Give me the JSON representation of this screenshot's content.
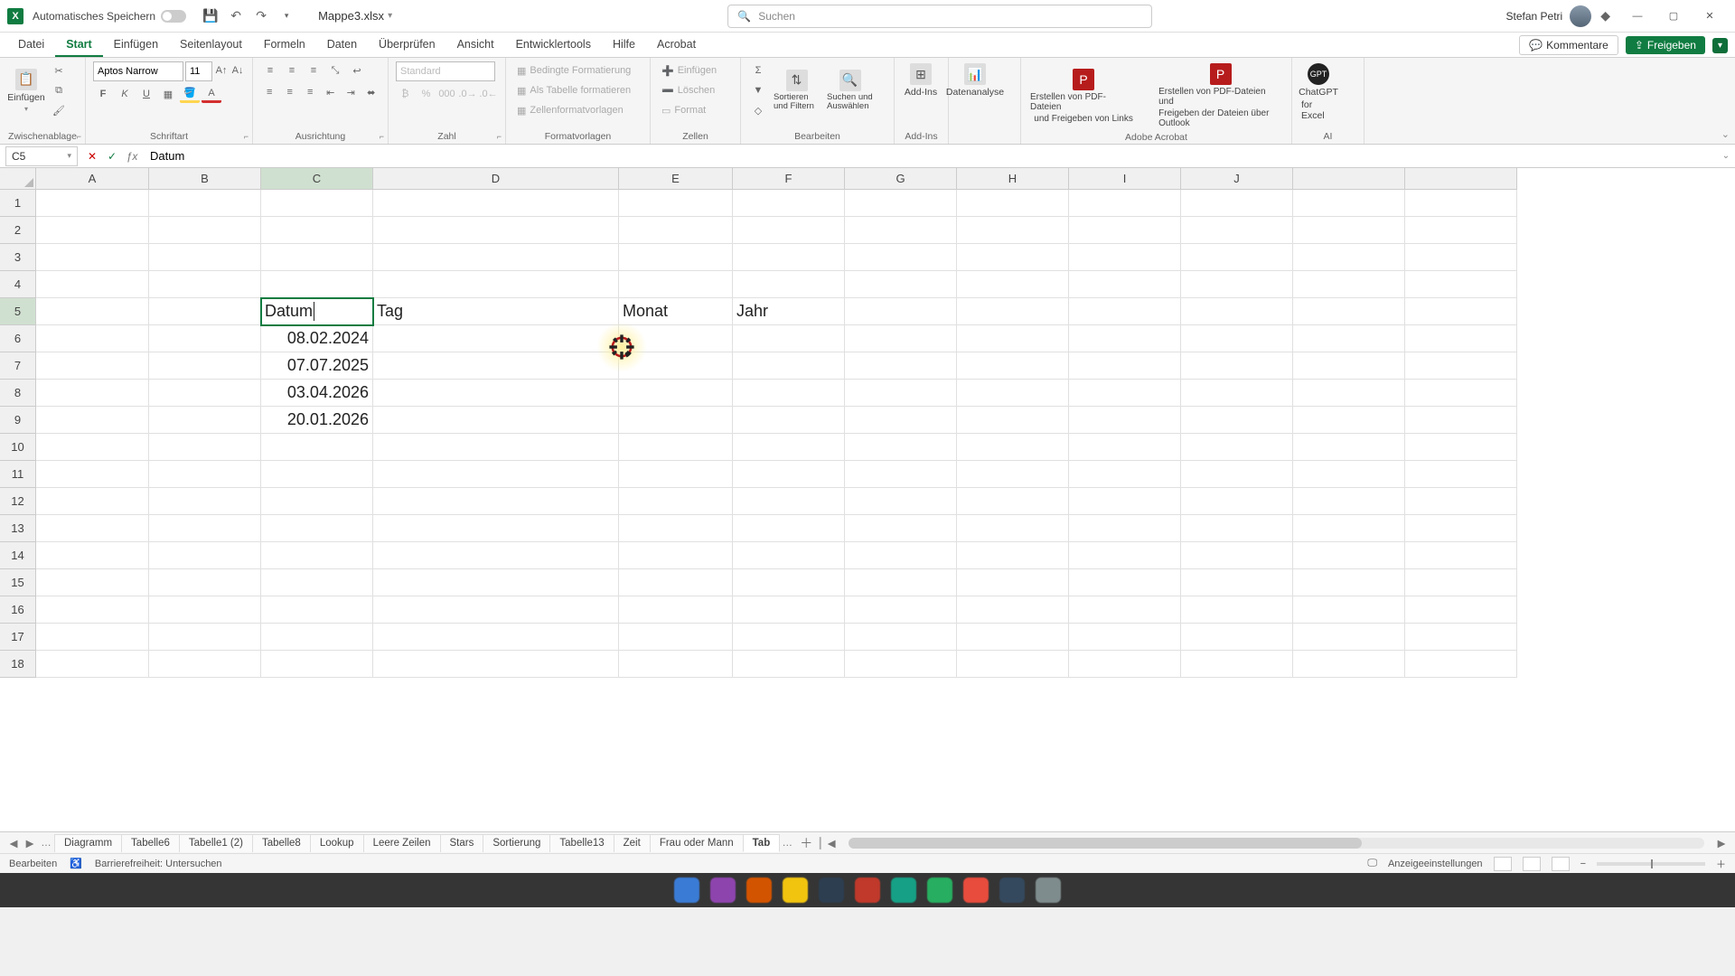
{
  "titlebar": {
    "autosave": "Automatisches Speichern",
    "docname": "Mappe3.xlsx",
    "search_placeholder": "Suchen",
    "user": "Stefan Petri"
  },
  "tabs": {
    "items": [
      "Datei",
      "Start",
      "Einfügen",
      "Seitenlayout",
      "Formeln",
      "Daten",
      "Überprüfen",
      "Ansicht",
      "Entwicklertools",
      "Hilfe",
      "Acrobat"
    ],
    "active": "Start",
    "comments": "Kommentare",
    "share": "Freigeben"
  },
  "ribbon": {
    "clipboard": {
      "paste": "Einfügen",
      "label": "Zwischenablage"
    },
    "font": {
      "name": "Aptos Narrow",
      "size": "11",
      "label": "Schriftart"
    },
    "align": {
      "label": "Ausrichtung"
    },
    "number": {
      "format": "Standard",
      "label": "Zahl"
    },
    "styles": {
      "cond": "Bedingte Formatierung",
      "table": "Als Tabelle formatieren",
      "cellstyles": "Zellenformatvorlagen",
      "label": "Formatvorlagen"
    },
    "cells": {
      "insert": "Einfügen",
      "delete": "Löschen",
      "format": "Format",
      "label": "Zellen"
    },
    "editing": {
      "sort": "Sortieren und Filtern",
      "find": "Suchen und Auswählen",
      "label": "Bearbeiten"
    },
    "addins": {
      "addins": "Add-Ins",
      "label": "Add-Ins"
    },
    "data": {
      "analysis": "Datenanalyse"
    },
    "acrobat": {
      "pdf1a": "Erstellen von PDF-Dateien",
      "pdf1b": "und Freigeben von Links",
      "pdf2a": "Erstellen von PDF-Dateien und",
      "pdf2b": "Freigeben der Dateien über Outlook",
      "label": "Adobe Acrobat"
    },
    "gpt": {
      "name": "ChatGPT",
      "sub": "for Excel",
      "label": "AI"
    }
  },
  "fxbar": {
    "ref": "C5",
    "formula": "Datum"
  },
  "columns": [
    "A",
    "B",
    "C",
    "D",
    "E",
    "F",
    "G",
    "H",
    "I",
    "J"
  ],
  "rows": 18,
  "selection": {
    "col": "C",
    "row": 5
  },
  "cells": {
    "C5": {
      "text": "Datum",
      "align": "left",
      "editing": true
    },
    "D5": {
      "text": "Tag",
      "align": "left"
    },
    "E5": {
      "text": "Monat",
      "align": "left"
    },
    "F5": {
      "text": "Jahr",
      "align": "left"
    },
    "C6": {
      "text": "08.02.2024",
      "align": "right"
    },
    "C7": {
      "text": "07.07.2025",
      "align": "right"
    },
    "C8": {
      "text": "03.04.2026",
      "align": "right"
    },
    "C9": {
      "text": "20.01.2026",
      "align": "right"
    }
  },
  "sheets": {
    "items": [
      "Diagramm",
      "Tabelle6",
      "Tabelle1 (2)",
      "Tabelle8",
      "Lookup",
      "Leere Zeilen",
      "Stars",
      "Sortierung",
      "Tabelle13",
      "Zeit",
      "Frau oder Mann",
      "Tab"
    ],
    "active": "Tab"
  },
  "statusbar": {
    "mode": "Bearbeiten",
    "access": "Barrierefreiheit: Untersuchen",
    "display": "Anzeigeeinstellungen"
  }
}
